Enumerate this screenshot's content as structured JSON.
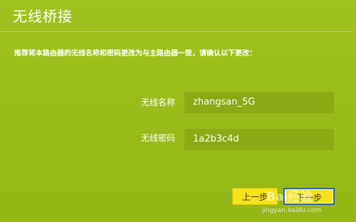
{
  "title": "无线桥接",
  "instruction": "推荐将本路由器的无线名称和密码更改为与主路由器一致，请确认以下更改：",
  "fields": {
    "ssid": {
      "label": "无线名称",
      "value": "zhangsan_5G"
    },
    "password": {
      "label": "无线密码",
      "value": "1a2b3c4d"
    }
  },
  "buttons": {
    "prev": "上一步",
    "next": "下一步"
  },
  "watermark": {
    "logo": "Bai经验",
    "url": "jingyan.baidu.com"
  }
}
